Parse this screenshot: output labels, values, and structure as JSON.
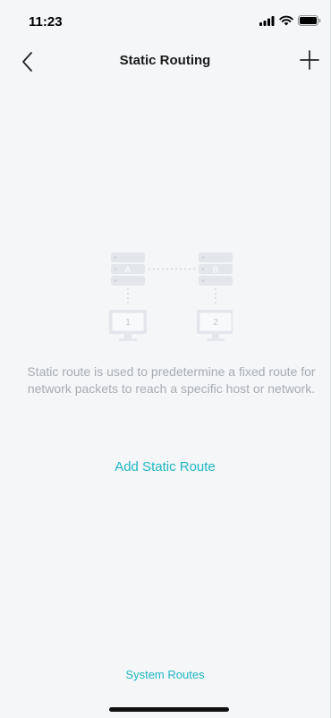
{
  "status_bar": {
    "time": "11:23"
  },
  "nav": {
    "title": "Static Routing",
    "back_icon": "chevron-left-icon",
    "add_icon": "plus-icon"
  },
  "illustration": {
    "router_a": "A",
    "router_b": "B",
    "host_1": "1",
    "host_2": "2"
  },
  "empty_state": {
    "description": "Static route is used to predetermine a fixed route for network packets to reach a specific host or network.",
    "add_label": "Add Static Route"
  },
  "footer": {
    "system_routes_label": "System Routes"
  },
  "colors": {
    "accent": "#1fb7c2",
    "background": "#f4f6f8",
    "muted_text": "#a8adb3"
  }
}
